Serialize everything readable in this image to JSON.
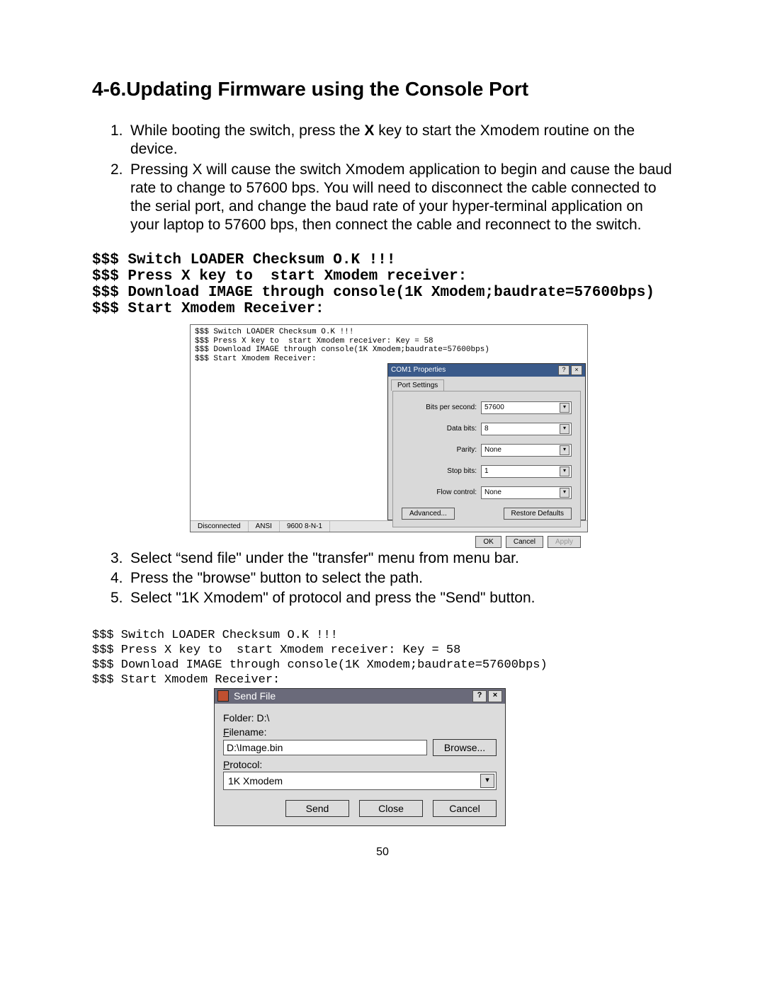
{
  "heading": "4-6.Updating Firmware using the Console Port",
  "steps_a": [
    {
      "n": "1.",
      "t_pre": "While booting the switch, press the ",
      "bold": "X",
      "t_post": " key to start the Xmodem routine on the device."
    },
    {
      "n": "2.",
      "t": "Pressing X will cause the switch Xmodem application to begin and cause the baud rate to change to 57600 bps.  You will need to disconnect the cable connected to the serial port, and change the baud rate of your hyper-terminal application on your laptop to 57600 bps, then connect the cable and reconnect to the switch."
    }
  ],
  "console1": "$$$ Switch LOADER Checksum O.K !!!\n$$$ Press X key to  start Xmodem receiver:\n$$$ Download IMAGE through console(1K Xmodem;baudrate=57600bps)\n$$$ Start Xmodem Receiver:",
  "com_shot": {
    "term": "$$$ Switch LOADER Checksum O.K !!!\n$$$ Press X key to  start Xmodem receiver: Key = 58\n$$$ Download IMAGE through console(1K Xmodem;baudrate=57600bps)\n$$$ Start Xmodem Receiver:",
    "dlg_title": "COM1 Properties",
    "tab": "Port Settings",
    "fields": {
      "bps_label": "Bits per second:",
      "bps": "57600",
      "db_label": "Data bits:",
      "db": "8",
      "parity_label": "Parity:",
      "parity": "None",
      "sb_label": "Stop bits:",
      "sb": "1",
      "fc_label": "Flow control:",
      "fc": "None"
    },
    "adv": "Advanced...",
    "restore": "Restore Defaults",
    "ok": "OK",
    "cancel": "Cancel",
    "apply": "Apply",
    "status": {
      "s1": "Disconnected",
      "s2": "ANSI",
      "s3": "9600 8-N-1"
    }
  },
  "steps_b": [
    {
      "n": "3.",
      "t": "Select “send file\" under the \"transfer\" menu from menu bar."
    },
    {
      "n": "4.",
      "t": "Press the \"browse\" button to select the path."
    },
    {
      "n": "5.",
      "t": "Select \"1K Xmodem\" of protocol and press the \"Send\" button."
    }
  ],
  "sf_term": "$$$ Switch LOADER Checksum O.K !!!\n$$$ Press X key to  start Xmodem receiver: Key = 58\n$$$ Download IMAGE through console(1K Xmodem;baudrate=57600bps)\n$$$ Start Xmodem Receiver:",
  "sf": {
    "title": "Send File",
    "folder_label": "Folder: D:\\",
    "filename_label": "Filename:",
    "filename": "D:\\Image.bin",
    "protocol_label": "Protocol:",
    "protocol": "1K Xmodem",
    "browse": "Browse...",
    "send": "Send",
    "close": "Close",
    "cancel": "Cancel"
  },
  "page_number": "50"
}
